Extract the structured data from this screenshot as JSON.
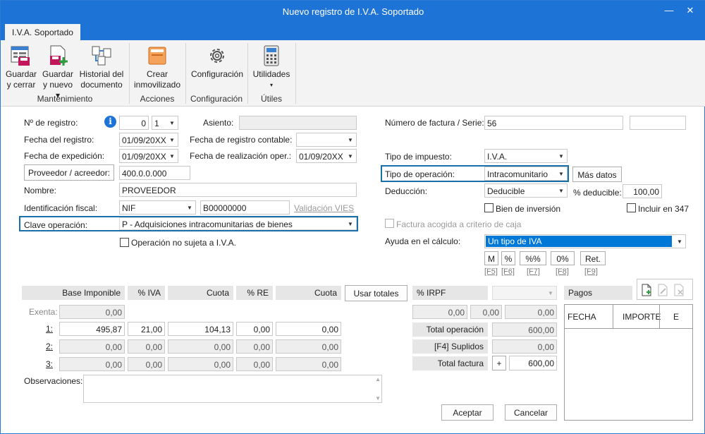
{
  "window": {
    "title": "Nuevo registro de I.V.A. Soportado",
    "minimize": "—",
    "close": "✕"
  },
  "tabs": [
    "I.V.A. Soportado"
  ],
  "ribbon": {
    "guardar_cerrar": [
      "Guardar",
      "y cerrar"
    ],
    "guardar_nuevo": [
      "Guardar",
      "y nuevo ▾"
    ],
    "historial": [
      "Historial del",
      "documento"
    ],
    "crear_inmov": [
      "Crear",
      "inmovilizado"
    ],
    "configuracion": "Configuración",
    "utilidades": [
      "Utilidades",
      "▾"
    ],
    "groups": {
      "mantenimiento": "Mantenimiento",
      "acciones": "Acciones",
      "configuracion": "Configuración",
      "utiles": "Útiles"
    }
  },
  "form": {
    "num_registro_label": "Nº de registro:",
    "num_registro_value": "0",
    "num_registro_serie": "1",
    "asiento_label": "Asiento:",
    "asiento_value": "",
    "fecha_registro_label": "Fecha del registro:",
    "fecha_registro_value": "01/09/20XX",
    "fecha_contable_label": "Fecha de registro contable:",
    "fecha_contable_value": "",
    "fecha_expedicion_label": "Fecha de expedición:",
    "fecha_expedicion_value": "01/09/20XX",
    "fecha_realizacion_label": "Fecha de realización oper.:",
    "fecha_realizacion_value": "01/09/20XX",
    "proveedor_button": "Proveedor / acreedor:",
    "proveedor_value": "400.0.0.000",
    "nombre_label": "Nombre:",
    "nombre_value": "PROVEEDOR",
    "id_fiscal_label": "Identificación fiscal:",
    "id_fiscal_type": "NIF",
    "id_fiscal_value": "B00000000",
    "validacion_vies": "Validación VIES",
    "clave_operacion_label": "Clave operación:",
    "clave_operacion_value": "P - Adquisiciones intracomunitarias de bienes",
    "no_sujeta_label": "Operación no sujeta a I.V.A.",
    "num_factura_label": "Número de factura / Serie:",
    "num_factura_value": "56",
    "serie_value": "",
    "tipo_impuesto_label": "Tipo de impuesto:",
    "tipo_impuesto_value": "I.V.A.",
    "tipo_operacion_label": "Tipo de operación:",
    "tipo_operacion_value": "Intracomunitario",
    "mas_datos": "Más datos",
    "deduccion_label": "Deducción:",
    "deduccion_value": "Deducible",
    "pct_deducible_label": "% deducible:",
    "pct_deducible_value": "100,00",
    "bien_inversion_label": "Bien de inversión",
    "incluir_347_label": "Incluir en 347",
    "criterio_caja_label": "Factura acogida a criterio de caja",
    "ayuda_calculo_label": "Ayuda en el cálculo:",
    "ayuda_calculo_value": "Un tipo de IVA",
    "quick_buttons": [
      {
        "label": "M",
        "key": "[F5]"
      },
      {
        "label": "%",
        "key": "[F6]"
      },
      {
        "label": "%%",
        "key": "[F7]"
      },
      {
        "label": "0%",
        "key": "[F8]"
      },
      {
        "label": "Ret.",
        "key": "[F9]"
      }
    ]
  },
  "grid": {
    "headers": {
      "base": "Base Imponible",
      "pct_iva": "% IVA",
      "cuota": "Cuota",
      "pct_re": "% RE",
      "cuota_re": "Cuota"
    },
    "usar_totales": "Usar totales",
    "irpf_label": "% IRPF",
    "exenta_label": "Exenta:",
    "exenta_value": "0,00",
    "rows": [
      {
        "label": "1:",
        "base": "495,87",
        "iva": "21,00",
        "cuota": "104,13",
        "re": "0,00",
        "cuota_re": "0,00"
      },
      {
        "label": "2:",
        "base": "0,00",
        "iva": "0,00",
        "cuota": "0,00",
        "re": "0,00",
        "cuota_re": "0,00"
      },
      {
        "label": "3:",
        "base": "0,00",
        "iva": "0,00",
        "cuota": "0,00",
        "re": "0,00",
        "cuota_re": "0,00"
      }
    ],
    "irpf_values": [
      "0,00",
      "0,00",
      "0,00"
    ],
    "total_operacion_label": "Total operación",
    "total_operacion_value": "600,00",
    "suplidos_label": "[F4] Suplidos",
    "suplidos_value": "0,00",
    "total_factura_label": "Total factura",
    "total_factura_sign": "+",
    "total_factura_value": "600,00"
  },
  "pagos": {
    "title": "Pagos",
    "columns": [
      "FECHA",
      "IMPORTE",
      "E"
    ]
  },
  "observaciones_label": "Observaciones:",
  "observaciones_value": "",
  "footer": {
    "aceptar": "Aceptar",
    "cancelar": "Cancelar"
  },
  "colors": {
    "titlebar": "#1e73d6",
    "highlight": "#1a6fa8",
    "selection": "#0078d7"
  }
}
